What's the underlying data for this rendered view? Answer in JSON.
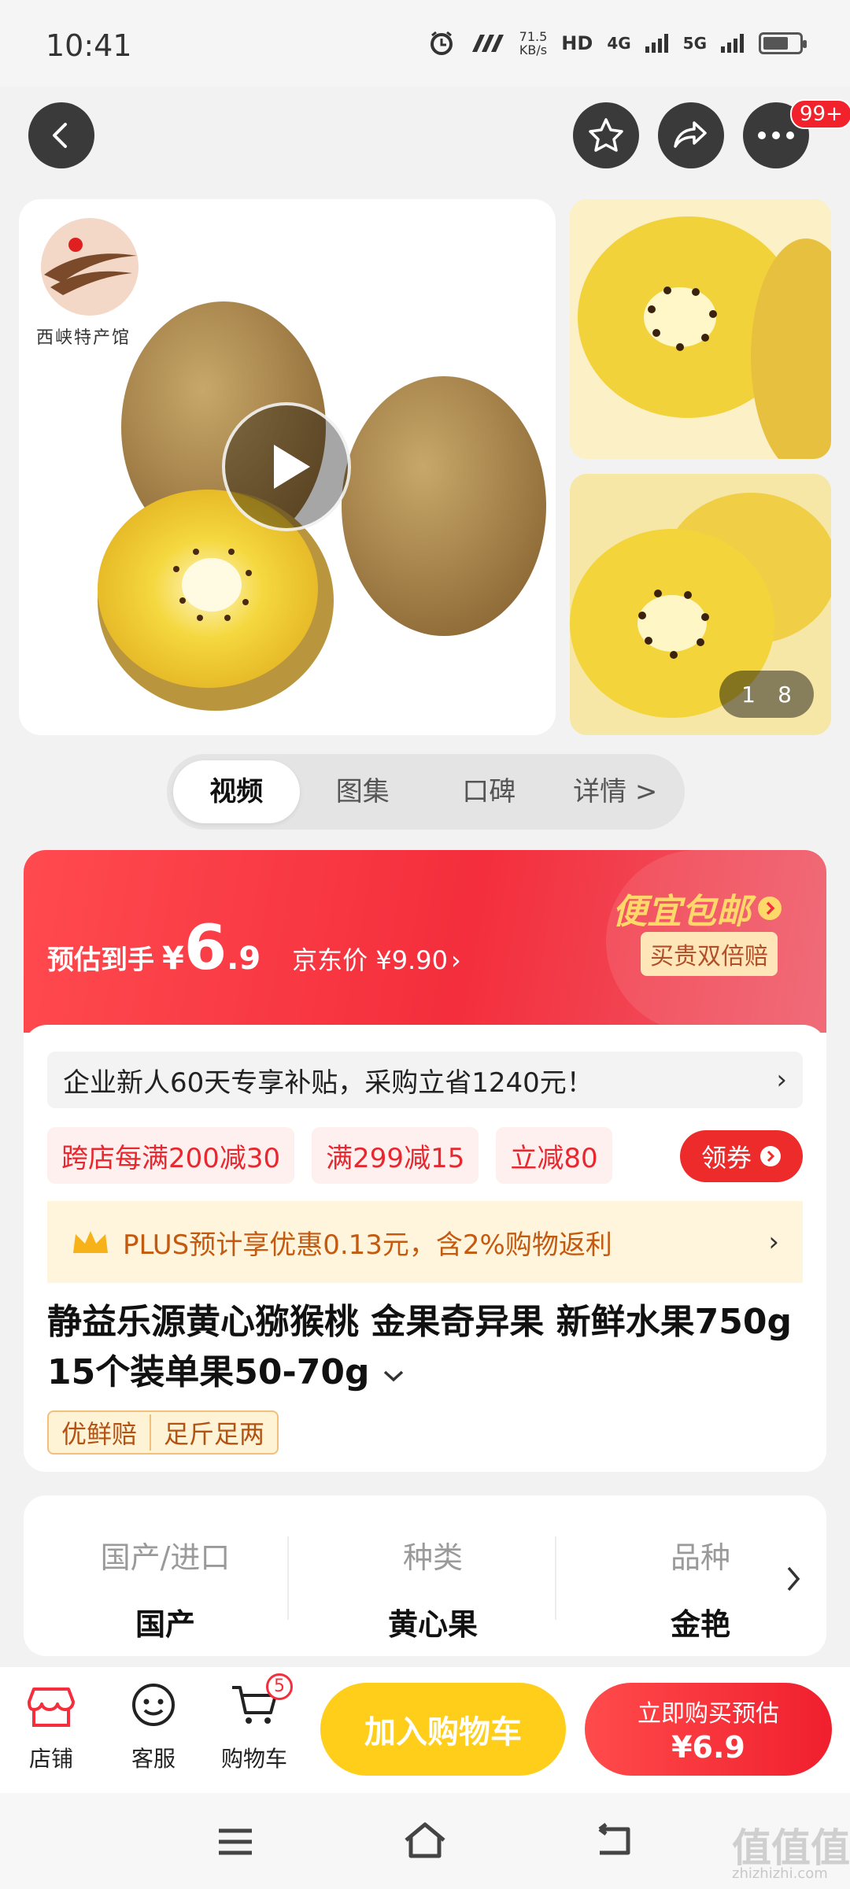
{
  "status_bar": {
    "time": "10:41",
    "network_speed": "71.5",
    "network_unit": "KB/s",
    "hd_label": "HD",
    "sim1": "4G",
    "sim2": "5G",
    "battery_level": 0.7
  },
  "header": {
    "more_badge": "99+"
  },
  "gallery": {
    "shop_logo_text": "西峡特产馆",
    "page_current": "1",
    "page_total": "8"
  },
  "tabs": [
    {
      "label": "视频"
    },
    {
      "label": "图集"
    },
    {
      "label": "口碑"
    },
    {
      "label": "详情 >"
    }
  ],
  "price": {
    "est_label": "预估到手",
    "currency": "¥",
    "est_integer": "6",
    "est_decimal": ".9",
    "jd_price_label": "京东价 ¥9.90",
    "jd_arrow": "›",
    "promo_title": "便宜包邮",
    "promo_badge": "买贵双倍赔"
  },
  "enterprise": {
    "text": "企业新人60天专享补贴，采购立省1240元！",
    "arrow": "›"
  },
  "coupons": [
    "跨店每满200减30",
    "满299减15",
    "立减80"
  ],
  "coupon_button": "领券",
  "plus": {
    "text": "PLUS预计享优惠0.13元，含2%购物返利",
    "arrow": "›"
  },
  "product": {
    "title": "静益乐源黄心猕猴桃 金果奇异果 新鲜水果750g 15个装单果50-70g",
    "tag1": "优鲜赔",
    "tag2": "足斤足两"
  },
  "specs": [
    {
      "key": "国产/进口",
      "value": "国产"
    },
    {
      "key": "种类",
      "value": "黄心果"
    },
    {
      "key": "品种",
      "value": "金艳"
    }
  ],
  "bottom": {
    "shop_label": "店铺",
    "service_label": "客服",
    "cart_label": "购物车",
    "cart_badge": "5",
    "add_cart": "加入购物车",
    "buy_line1": "立即购买预估",
    "buy_line2": "¥6.9"
  },
  "watermark": {
    "text": "值值值",
    "url": "zhizhizhi.com"
  },
  "colors": {
    "brand_red": "#f42e3c",
    "yellow": "#ffce1a",
    "gold": "#ffd86a"
  }
}
